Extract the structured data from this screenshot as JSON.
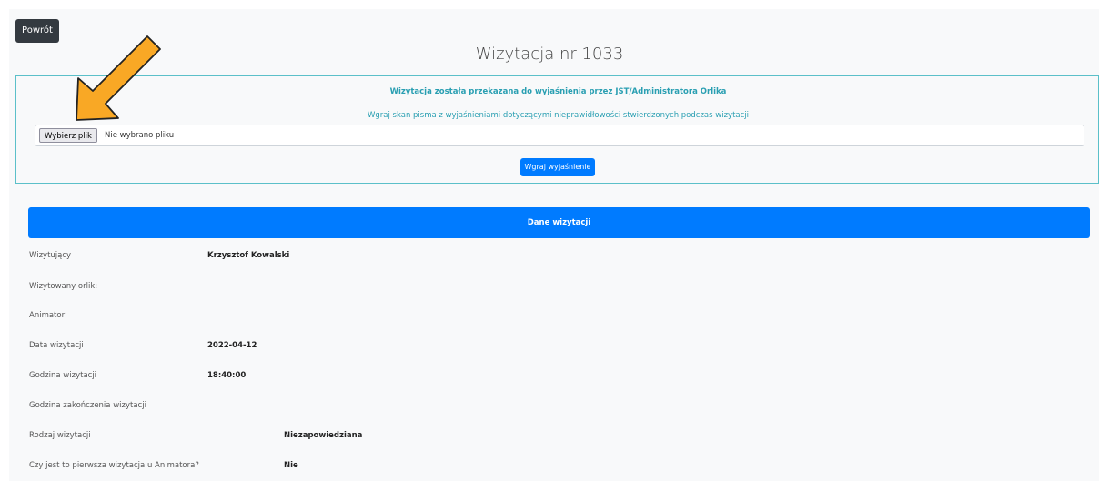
{
  "header": {
    "back_label": "Powrót",
    "title": "Wizytacja nr 1033"
  },
  "alert": {
    "title": "Wizytacja została przekazana do wyjaśnienia przez JST/Administratora Orlika",
    "description": "Wgraj skan pisma z wyjaśnieniami dotyczącymi nieprawidłowości stwierdzonych podczas wizytacji",
    "file_button_label": "Wybierz plik",
    "file_status": "Nie wybrano pliku",
    "upload_label": "Wgraj wyjaśnienie"
  },
  "details": {
    "section_title": "Dane wizytacji",
    "rows": [
      {
        "label": "Wizytujący",
        "value": "Krzysztof Kowalski"
      },
      {
        "label": "Wizytowany orlik:",
        "value": ""
      },
      {
        "label": "Animator",
        "value": ""
      },
      {
        "label": "Data wizytacji",
        "value": "2022-04-12"
      },
      {
        "label": "Godzina wizytacji",
        "value": "18:40:00"
      },
      {
        "label": "Godzina zakończenia wizytacji",
        "value": ""
      },
      {
        "label": "Rodzaj wizytacji",
        "value": "Niezapowiedziana"
      },
      {
        "label": "Czy jest to pierwsza wizytacja u Animatora?",
        "value": "Nie"
      }
    ]
  },
  "colors": {
    "primary": "#007bff",
    "dark": "#343a40",
    "info": "#2a9fb2",
    "arrow": "#f9a825"
  },
  "annotation": {
    "icon": "orange-arrow-icon"
  }
}
